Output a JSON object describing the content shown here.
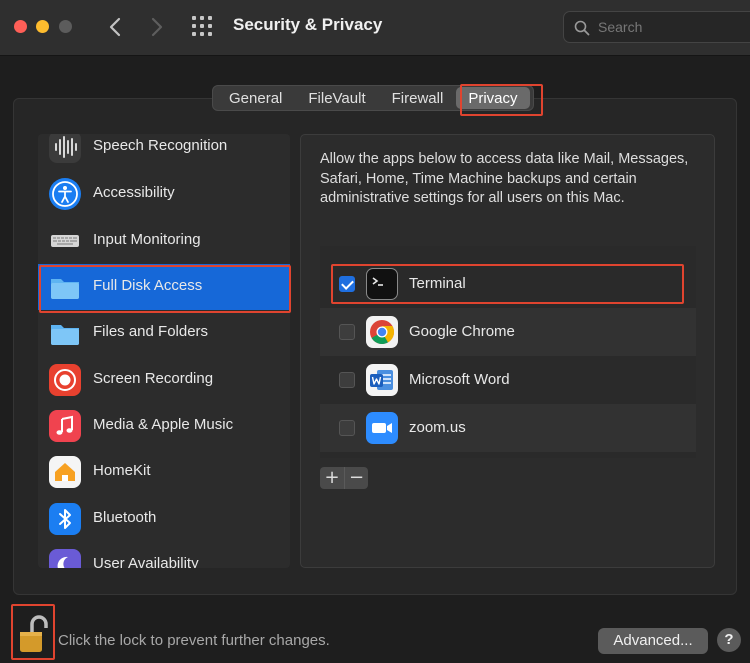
{
  "window": {
    "title": "Security & Privacy",
    "search_placeholder": "Search"
  },
  "tabs": [
    {
      "label": "General"
    },
    {
      "label": "FileVault"
    },
    {
      "label": "Firewall"
    },
    {
      "label": "Privacy",
      "active": true
    }
  ],
  "sidebar": {
    "items": [
      {
        "label": "Speech Recognition",
        "icon": "waveform-icon"
      },
      {
        "label": "Accessibility",
        "icon": "accessibility-icon"
      },
      {
        "label": "Input Monitoring",
        "icon": "keyboard-icon"
      },
      {
        "label": "Full Disk Access",
        "icon": "folder-icon",
        "selected": true
      },
      {
        "label": "Files and Folders",
        "icon": "folder-icon"
      },
      {
        "label": "Screen Recording",
        "icon": "record-icon"
      },
      {
        "label": "Media & Apple Music",
        "icon": "music-note-icon"
      },
      {
        "label": "HomeKit",
        "icon": "house-icon"
      },
      {
        "label": "Bluetooth",
        "icon": "bluetooth-icon"
      },
      {
        "label": "User Availability",
        "icon": "moon-icon"
      }
    ]
  },
  "panel": {
    "description": "Allow the apps below to access data like Mail, Messages, Safari, Home, Time Machine backups and certain administrative settings for all users on this Mac.",
    "apps": [
      {
        "label": "Terminal",
        "checked": true,
        "icon": "terminal-icon"
      },
      {
        "label": "Google Chrome",
        "checked": false,
        "icon": "chrome-icon"
      },
      {
        "label": "Microsoft Word",
        "checked": false,
        "icon": "word-icon"
      },
      {
        "label": "zoom.us",
        "checked": false,
        "icon": "zoom-icon"
      }
    ],
    "add_label": "+",
    "remove_label": "−"
  },
  "footer": {
    "lock_text": "Click the lock to prevent further changes.",
    "advanced_label": "Advanced...",
    "help_label": "?"
  },
  "colors": {
    "accent": "#1668d8",
    "highlight_box": "#e0442f"
  }
}
